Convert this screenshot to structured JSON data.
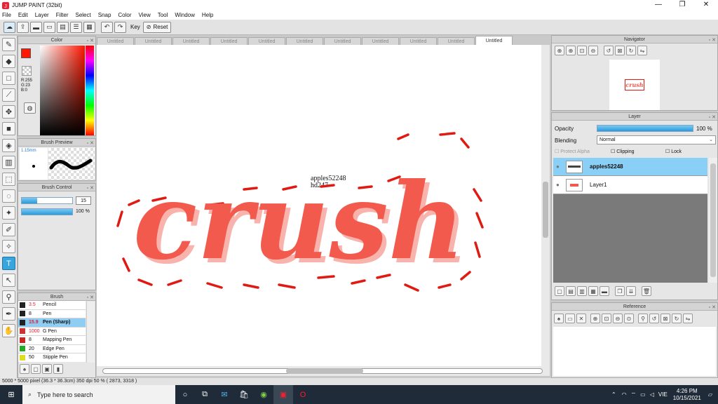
{
  "window": {
    "title": "JUMP PAINT (32bit)",
    "minimize": "—",
    "maximize": "❐",
    "close": "✕"
  },
  "menu": [
    "File",
    "Edit",
    "Layer",
    "Filter",
    "Select",
    "Snap",
    "Color",
    "View",
    "Tool",
    "Window",
    "Help"
  ],
  "toolbar": {
    "key_label": "Key",
    "reset_label": "Reset"
  },
  "tabs": [
    "Untitled",
    "Untitled",
    "Untitled",
    "Untitled",
    "Untitled",
    "Untitled",
    "Untitled",
    "Untitled",
    "Untitled",
    "Untitled",
    "Untitled"
  ],
  "color_panel": {
    "title": "Color",
    "r": "R:255",
    "g": "G:23",
    "b": "B:0",
    "fg_color": "#ff1700"
  },
  "brush_preview": {
    "title": "Brush Preview",
    "size": "1.15mm"
  },
  "brush_control": {
    "title": "Brush Control",
    "size_value": "15",
    "opacity_value": "100 %",
    "size_fraction": 0.3,
    "opacity_fraction": 1.0
  },
  "brush_panel": {
    "title": "Brush",
    "items": [
      {
        "size": "3.5",
        "name": "Pencil",
        "color": "#222222"
      },
      {
        "size": "8",
        "name": "Pen",
        "color": "#222222"
      },
      {
        "size": "15.9",
        "name": "Pen (Sharp)",
        "color": "#222222"
      },
      {
        "size": "1000",
        "name": "G Pen",
        "color": "#cc3333"
      },
      {
        "size": "8",
        "name": "Mapping Pen",
        "color": "#cc2222"
      },
      {
        "size": "20",
        "name": "Edge Pen",
        "color": "#22aa22"
      },
      {
        "size": "50",
        "name": "Stipple Pen",
        "color": "#dddd22"
      }
    ]
  },
  "canvas": {
    "artwork_text": "crush",
    "watermark_line1": "apples52248",
    "watermark_line2": "hd247"
  },
  "navigator": {
    "title": "Navigator",
    "thumb_text": "crush"
  },
  "layer_panel": {
    "title": "Layer",
    "opacity_label": "Opacity",
    "opacity_value": "100 %",
    "opacity_fraction": 1.0,
    "blending_label": "Blending",
    "blending_value": "Normal",
    "protect_alpha": "Protect Alpha",
    "clipping": "Clipping",
    "lock": "Lock",
    "layers": [
      {
        "name": "apples52248",
        "selected": true
      },
      {
        "name": "Layer1",
        "selected": false
      }
    ]
  },
  "reference": {
    "title": "Reference"
  },
  "status": {
    "text": "5000 * 5000 pixel  (36.3 * 36.3cm)  350 dpi  50 %  ( 2873, 3318 )"
  },
  "taskbar": {
    "search_placeholder": "Type here to search",
    "time": "4:26 PM",
    "date": "10/15/2021",
    "lang": "VIE"
  }
}
